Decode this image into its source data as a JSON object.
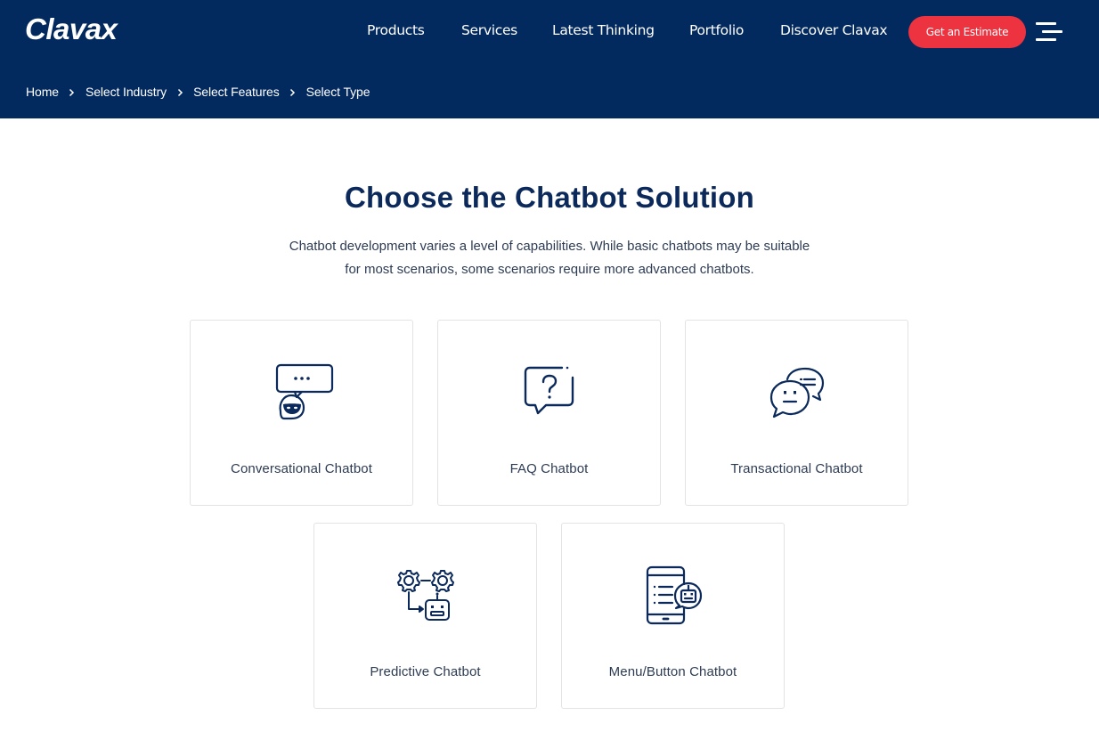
{
  "header": {
    "logo": "Clavax",
    "nav": [
      {
        "label": "Products"
      },
      {
        "label": "Services"
      },
      {
        "label": "Latest Thinking"
      },
      {
        "label": "Portfolio"
      },
      {
        "label": "Discover Clavax"
      }
    ],
    "cta_label": "Get an Estimate",
    "menu_icon": "hamburger-menu-icon",
    "colors": {
      "background": "#032a5e",
      "cta": "#ee3340",
      "text": "#ffffff"
    }
  },
  "breadcrumb": {
    "items": [
      {
        "label": "Home"
      },
      {
        "label": "Select Industry"
      },
      {
        "label": "Select Features"
      },
      {
        "label": "Select Type"
      }
    ],
    "separator_icon": "chevron-right-icon"
  },
  "main": {
    "title": "Choose the Chatbot Solution",
    "subtitle_line1": "Chatbot development varies a level of capabilities. While basic chatbots may be suitable",
    "subtitle_line2": "for most scenarios, some scenarios require more advanced chatbots.",
    "cards": [
      {
        "label": "Conversational Chatbot",
        "icon": "conversational-bot-icon"
      },
      {
        "label": "FAQ Chatbot",
        "icon": "faq-question-bubble-icon"
      },
      {
        "label": "Transactional Chatbot",
        "icon": "chat-bubbles-icon"
      },
      {
        "label": "Predictive Chatbot",
        "icon": "gears-robot-icon"
      },
      {
        "label": "Menu/Button Chatbot",
        "icon": "phone-menu-bot-icon"
      }
    ],
    "colors": {
      "title": "#0b2a5b",
      "icon_stroke": "#0b2a5b",
      "card_border": "#e3e3e3"
    }
  }
}
